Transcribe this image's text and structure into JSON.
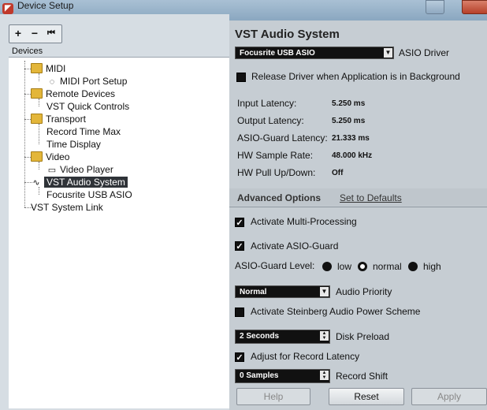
{
  "window": {
    "title": "Device Setup"
  },
  "toolbar": {
    "add": "+",
    "remove": "−",
    "reset": "⏮"
  },
  "devices_header": "Devices",
  "tree": {
    "midi": "MIDI",
    "midi_port_setup": "MIDI Port Setup",
    "remote_devices": "Remote Devices",
    "vst_quick_controls": "VST Quick Controls",
    "transport": "Transport",
    "record_time_max": "Record Time Max",
    "time_display": "Time Display",
    "video": "Video",
    "video_player": "Video Player",
    "vst_audio_system": "VST Audio System",
    "focusrite_usb_asio": "Focusrite USB ASIO",
    "vst_system_link": "VST System Link"
  },
  "panel": {
    "title": "VST Audio System",
    "asio_driver_value": "Focusrite USB ASIO",
    "asio_driver_label": "ASIO Driver",
    "release_driver_label": "Release Driver when Application is in Background",
    "input_latency_label": "Input Latency:",
    "input_latency_value": "5.250 ms",
    "output_latency_label": "Output Latency:",
    "output_latency_value": "5.250 ms",
    "asio_guard_latency_label": "ASIO-Guard Latency:",
    "asio_guard_latency_value": "21.333 ms",
    "hw_sample_rate_label": "HW Sample Rate:",
    "hw_sample_rate_value": "48.000 kHz",
    "hw_pull_label": "HW Pull Up/Down:",
    "hw_pull_value": "Off",
    "advanced_options": "Advanced Options",
    "set_to_defaults": "Set to Defaults",
    "multi_processing_label": "Activate Multi-Processing",
    "asio_guard_label": "Activate ASIO-Guard",
    "asio_guard_level_label": "ASIO-Guard Level:",
    "level_low": "low",
    "level_normal": "normal",
    "level_high": "high",
    "audio_priority_value": "Normal",
    "audio_priority_label": "Audio Priority",
    "power_scheme_label": "Activate Steinberg Audio Power Scheme",
    "disk_preload_value": "2 Seconds",
    "disk_preload_label": "Disk Preload",
    "adjust_latency_label": "Adjust for Record Latency",
    "record_shift_value": "0 Samples",
    "record_shift_label": "Record Shift"
  },
  "buttons": {
    "help": "Help",
    "reset": "Reset",
    "apply": "Apply"
  }
}
